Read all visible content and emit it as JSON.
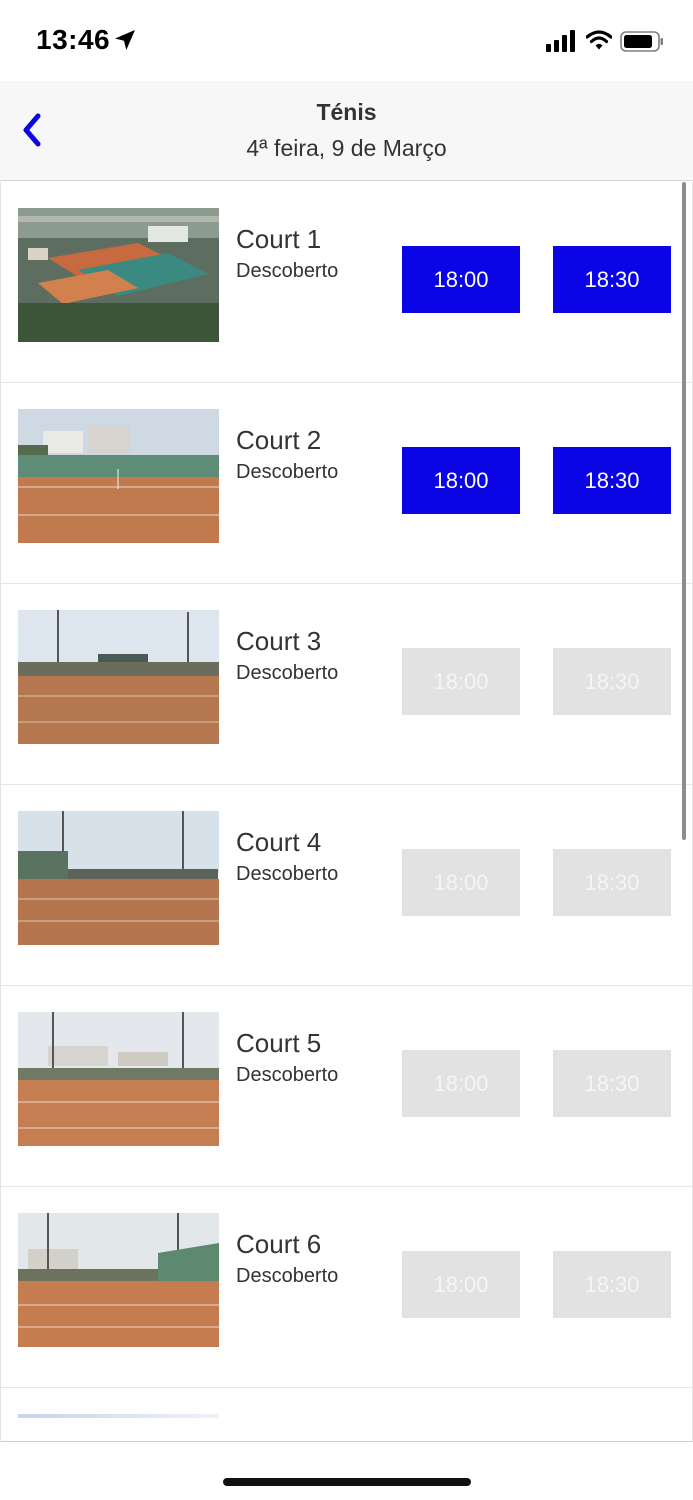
{
  "status_bar": {
    "time": "13:46",
    "icons": [
      "location-arrow-icon",
      "cellular-signal-icon",
      "wifi-icon",
      "battery-icon"
    ]
  },
  "header": {
    "back_icon": "chevron-left-icon",
    "title": "Ténis",
    "subtitle": "4ª feira, 9 de Março"
  },
  "colors": {
    "accent": "#0b05e6",
    "slot_unavailable_bg": "#e2e2e2",
    "slot_unavailable_text": "#f5f5f5"
  },
  "courts": [
    {
      "name": "Court 1",
      "type": "Descoberto",
      "slots": [
        {
          "time": "18:00",
          "available": true
        },
        {
          "time": "18:30",
          "available": true
        }
      ]
    },
    {
      "name": "Court 2",
      "type": "Descoberto",
      "slots": [
        {
          "time": "18:00",
          "available": true
        },
        {
          "time": "18:30",
          "available": true
        }
      ]
    },
    {
      "name": "Court 3",
      "type": "Descoberto",
      "slots": [
        {
          "time": "18:00",
          "available": false
        },
        {
          "time": "18:30",
          "available": false
        }
      ]
    },
    {
      "name": "Court 4",
      "type": "Descoberto",
      "slots": [
        {
          "time": "18:00",
          "available": false
        },
        {
          "time": "18:30",
          "available": false
        }
      ]
    },
    {
      "name": "Court 5",
      "type": "Descoberto",
      "slots": [
        {
          "time": "18:00",
          "available": false
        },
        {
          "time": "18:30",
          "available": false
        }
      ]
    },
    {
      "name": "Court 6",
      "type": "Descoberto",
      "slots": [
        {
          "time": "18:00",
          "available": false
        },
        {
          "time": "18:30",
          "available": false
        }
      ]
    }
  ]
}
